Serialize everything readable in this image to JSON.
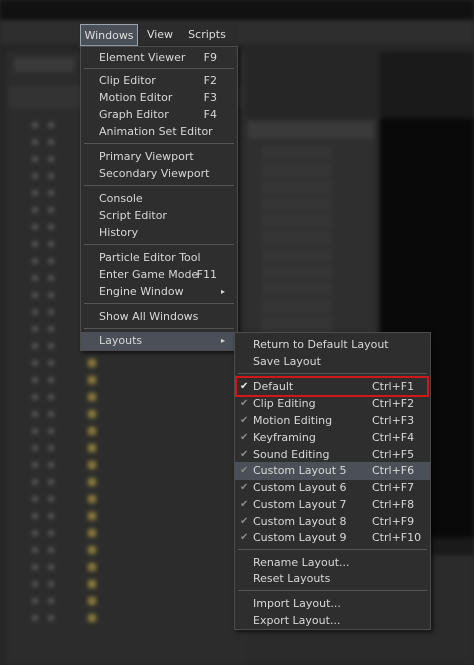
{
  "menubar": {
    "items": [
      "Windows",
      "View",
      "Scripts"
    ]
  },
  "windows_menu": {
    "items": [
      {
        "label": "Element Viewer",
        "shortcut": "F9"
      },
      {
        "label": "Clip Editor",
        "shortcut": "F2"
      },
      {
        "label": "Motion Editor",
        "shortcut": "F3"
      },
      {
        "label": "Graph Editor",
        "shortcut": "F4"
      },
      {
        "label": "Animation Set Editor",
        "shortcut": ""
      },
      {
        "label": "Primary Viewport",
        "shortcut": ""
      },
      {
        "label": "Secondary Viewport",
        "shortcut": ""
      },
      {
        "label": "Console",
        "shortcut": ""
      },
      {
        "label": "Script Editor",
        "shortcut": ""
      },
      {
        "label": "History",
        "shortcut": ""
      },
      {
        "label": "Particle Editor Tool",
        "shortcut": ""
      },
      {
        "label": "Enter Game Mode",
        "shortcut": "F11"
      },
      {
        "label": "Engine Window",
        "shortcut": ""
      },
      {
        "label": "Show All Windows",
        "shortcut": ""
      },
      {
        "label": "Layouts",
        "shortcut": ""
      }
    ],
    "submenu_arrow": "▸"
  },
  "layouts_menu": {
    "items": [
      {
        "label": "Return to Default Layout",
        "shortcut": "",
        "check": ""
      },
      {
        "label": "Save Layout",
        "shortcut": "",
        "check": ""
      },
      {
        "label": "Default",
        "shortcut": "Ctrl+F1",
        "check": "✔"
      },
      {
        "label": "Clip Editing",
        "shortcut": "Ctrl+F2",
        "check": "✔"
      },
      {
        "label": "Motion Editing",
        "shortcut": "Ctrl+F3",
        "check": "✔"
      },
      {
        "label": "Keyframing",
        "shortcut": "Ctrl+F4",
        "check": "✔"
      },
      {
        "label": "Sound Editing",
        "shortcut": "Ctrl+F5",
        "check": "✔"
      },
      {
        "label": "Custom Layout 5",
        "shortcut": "Ctrl+F6",
        "check": "✔"
      },
      {
        "label": "Custom Layout 6",
        "shortcut": "Ctrl+F7",
        "check": "✔"
      },
      {
        "label": "Custom Layout 7",
        "shortcut": "Ctrl+F8",
        "check": "✔"
      },
      {
        "label": "Custom Layout 8",
        "shortcut": "Ctrl+F9",
        "check": "✔"
      },
      {
        "label": "Custom Layout 9",
        "shortcut": "Ctrl+F10",
        "check": "✔"
      },
      {
        "label": "Rename Layout...",
        "shortcut": "",
        "check": ""
      },
      {
        "label": "Reset Layouts",
        "shortcut": "",
        "check": ""
      },
      {
        "label": "Import Layout...",
        "shortcut": "",
        "check": ""
      },
      {
        "label": "Export Layout...",
        "shortcut": "",
        "check": ""
      }
    ]
  },
  "colors": {
    "menu_bg": "#2e2e2e",
    "menu_highlight": "#4a4f58",
    "callout": "#d01818"
  }
}
